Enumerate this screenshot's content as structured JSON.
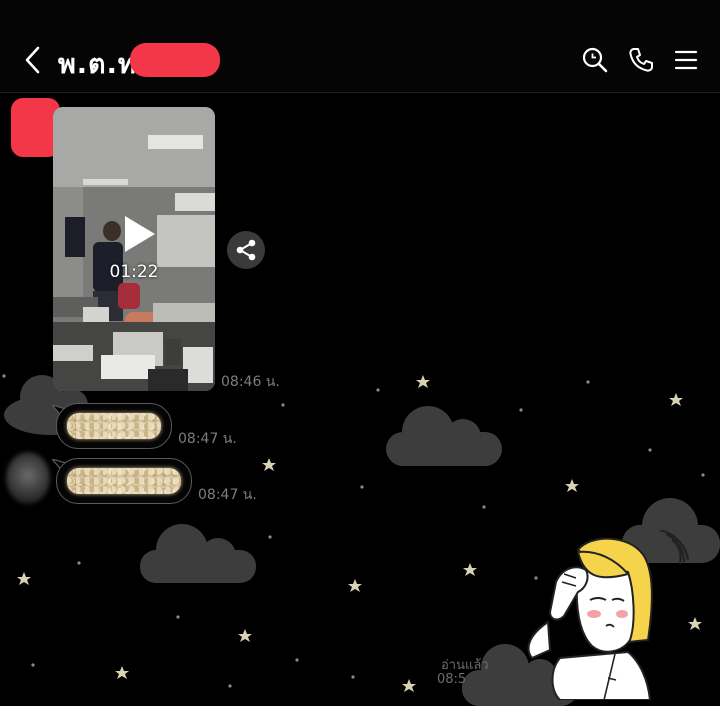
{
  "header": {
    "title": "พ.ต.ท",
    "icons": [
      "back-arrow-icon",
      "search-icon",
      "phone-icon",
      "menu-icon"
    ]
  },
  "messages": [
    {
      "type": "video",
      "duration": "01:22",
      "time": "08:46 น."
    },
    {
      "type": "text-redacted",
      "time": "08:47 น."
    },
    {
      "type": "text-redacted",
      "time": "08:47 น."
    }
  ],
  "sent": {
    "read_label": "อ่านแล้ว",
    "time": "08:5"
  },
  "colors": {
    "redaction": "#f43649",
    "background": "#000000",
    "timestamp": "#7d7d7d"
  }
}
